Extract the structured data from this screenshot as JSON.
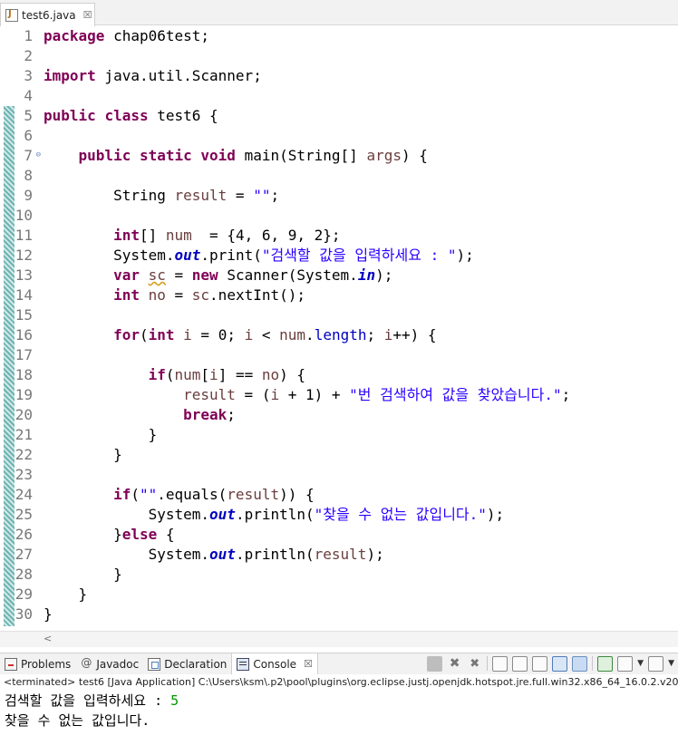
{
  "editor_tab": {
    "filename": "test6.java",
    "close": "☒"
  },
  "code_lines": [
    {
      "n": "1"
    },
    {
      "n": "2"
    },
    {
      "n": "3"
    },
    {
      "n": "4"
    },
    {
      "n": "5"
    },
    {
      "n": "6"
    },
    {
      "n": "7"
    },
    {
      "n": "8"
    },
    {
      "n": "9"
    },
    {
      "n": "10"
    },
    {
      "n": "11"
    },
    {
      "n": "12"
    },
    {
      "n": "13"
    },
    {
      "n": "14"
    },
    {
      "n": "15"
    },
    {
      "n": "16"
    },
    {
      "n": "17"
    },
    {
      "n": "18"
    },
    {
      "n": "19"
    },
    {
      "n": "20"
    },
    {
      "n": "21"
    },
    {
      "n": "22"
    },
    {
      "n": "23"
    },
    {
      "n": "24"
    },
    {
      "n": "25"
    },
    {
      "n": "26"
    },
    {
      "n": "27"
    },
    {
      "n": "28"
    },
    {
      "n": "29"
    },
    {
      "n": "30"
    }
  ],
  "code": {
    "l1": [
      "package",
      " chap06test;"
    ],
    "l3": [
      "import",
      " java.util.Scanner;"
    ],
    "l5": [
      "public",
      " ",
      "class",
      " test6 {"
    ],
    "l7": [
      "    ",
      "public",
      " ",
      "static",
      " ",
      "void",
      " main(String[] ",
      "args",
      ") {"
    ],
    "l9": [
      "        String ",
      "result",
      " = ",
      "\"\"",
      ";"
    ],
    "l11": [
      "        ",
      "int",
      "[] ",
      "num",
      "  = {4, 6, 9, 2};"
    ],
    "l12": [
      "        System.",
      "out",
      ".print(",
      "\"검색할 값을 입력하세요 : \"",
      ");"
    ],
    "l13": [
      "        ",
      "var",
      " ",
      "sc",
      " = ",
      "new",
      " Scanner(System.",
      "in",
      ");"
    ],
    "l14": [
      "        ",
      "int",
      " ",
      "no",
      " = ",
      "sc",
      ".nextInt();"
    ],
    "l16": [
      "        ",
      "for",
      "(",
      "int",
      " ",
      "i",
      " = 0; ",
      "i",
      " < ",
      "num",
      ".",
      "length",
      "; ",
      "i",
      "++) {"
    ],
    "l18": [
      "            ",
      "if",
      "(",
      "num",
      "[",
      "i",
      "] == ",
      "no",
      ") {"
    ],
    "l19": [
      "                ",
      "result",
      " = (",
      "i",
      " + 1) + ",
      "\"번 검색하여 값을 찾았습니다.\"",
      ";"
    ],
    "l20": [
      "                ",
      "break",
      ";"
    ],
    "l21": [
      "            }"
    ],
    "l22": [
      "        }"
    ],
    "l24": [
      "        ",
      "if",
      "(",
      "\"\"",
      ".equals(",
      "result",
      ")) {"
    ],
    "l25": [
      "            System.",
      "out",
      ".println(",
      "\"찾을 수 없는 값입니다.\"",
      ");"
    ],
    "l26": [
      "        }",
      "else",
      " {"
    ],
    "l27": [
      "            System.",
      "out",
      ".println(",
      "result",
      ");"
    ],
    "l28": [
      "        }"
    ],
    "l29": [
      "    }"
    ],
    "l30": [
      "}"
    ]
  },
  "console_tabs": {
    "problems": "Problems",
    "javadoc": "Javadoc",
    "declaration": "Declaration",
    "console": "Console",
    "console_close": "☒"
  },
  "console": {
    "header": "<terminated> test6 [Java Application] C:\\Users\\ksm\\.p2\\pool\\plugins\\org.eclipse.justj.openjdk.hotspot.jre.full.win32.x86_64_16.0.2.v20",
    "prompt": "검색할 값을 입력하세요 : ",
    "user_input": "5",
    "result": "찾을 수 없는 값입니다."
  },
  "colors": {
    "keyword": "#7f0055",
    "string": "#2a00ff",
    "local_variable": "#6a3e3e",
    "field": "#0000c0",
    "line_number": "#787878",
    "console_input": "#009900"
  }
}
